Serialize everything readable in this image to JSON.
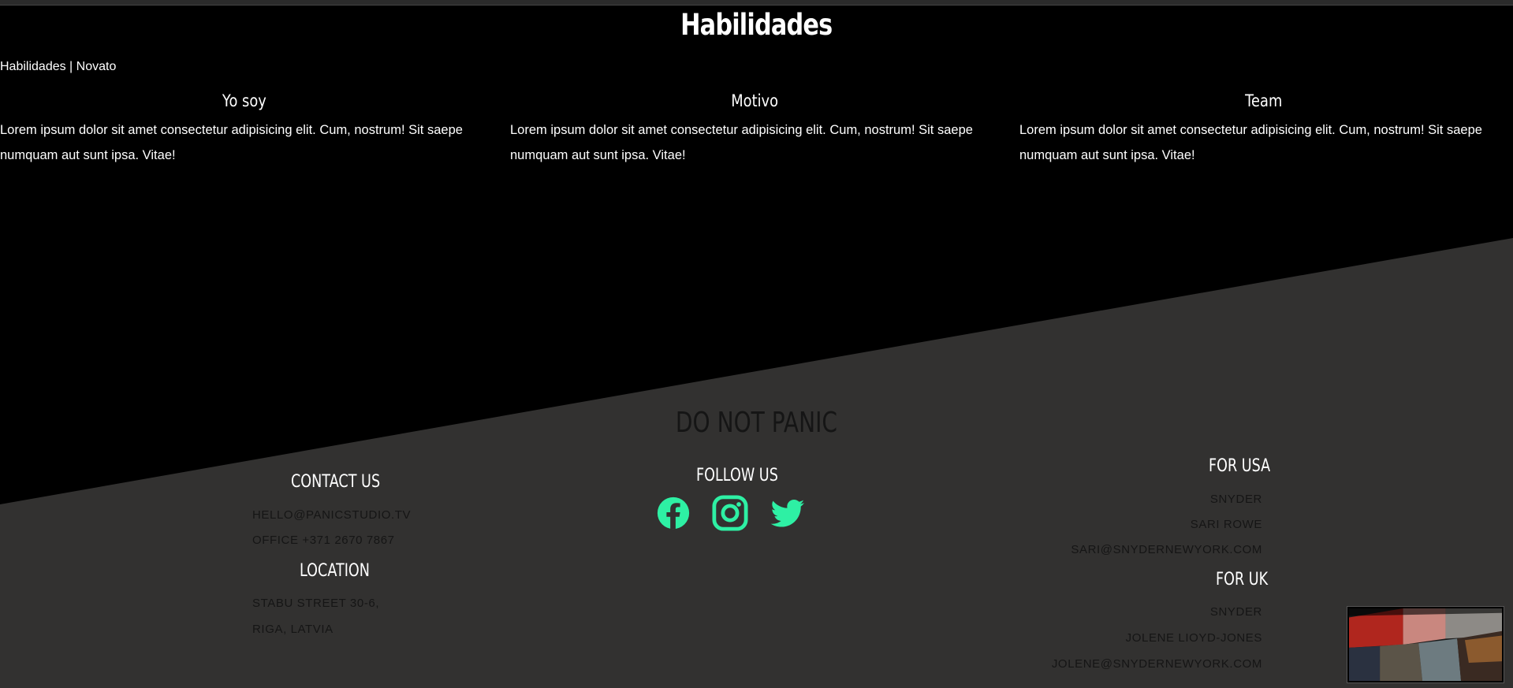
{
  "skills": {
    "title": "Habilidades",
    "breadcrumb": "Habilidades | Novato",
    "columns": [
      {
        "heading": "Yo soy",
        "text": "Lorem ipsum dolor sit amet consectetur adipisicing elit. Cum, nostrum! Sit saepe numquam aut sunt ipsa. Vitae!"
      },
      {
        "heading": "Motivo",
        "text": "Lorem ipsum dolor sit amet consectetur adipisicing elit. Cum, nostrum! Sit saepe numquam aut sunt ipsa. Vitae!"
      },
      {
        "heading": "Team",
        "text": "Lorem ipsum dolor sit amet consectetur adipisicing elit. Cum, nostrum! Sit saepe numquam aut sunt ipsa. Vitae!"
      }
    ]
  },
  "footer": {
    "brand": "DO NOT PANIC",
    "contact": {
      "heading": "CONTACT US",
      "email": "HELLO@PANICSTUDIO.TV",
      "phone": "OFFICE +371 2670 7867"
    },
    "location": {
      "heading": "LOCATION",
      "line1": "STABU STREET 30-6,",
      "line2": "RIGA, LATVIA"
    },
    "follow": {
      "heading": "FOLLOW US",
      "icons": [
        "facebook-icon",
        "instagram-icon",
        "twitter-icon"
      ],
      "icon_color": "#2ef0a4"
    },
    "usa": {
      "heading": "FOR USA",
      "company": "SNYDER",
      "name": "SARI ROWE",
      "email": "SARI@SNYDERNEWYORK.COM"
    },
    "uk": {
      "heading": "FOR UK",
      "company": "SNYDER",
      "name": "JOLENE LIOYD-JONES",
      "email": "JOLENE@SNYDERNEWYORK.COM"
    }
  },
  "colors": {
    "background_top": "#000000",
    "background_footer": "#323130",
    "accent": "#2ef0a4",
    "footer_text_dark": "#151515"
  }
}
